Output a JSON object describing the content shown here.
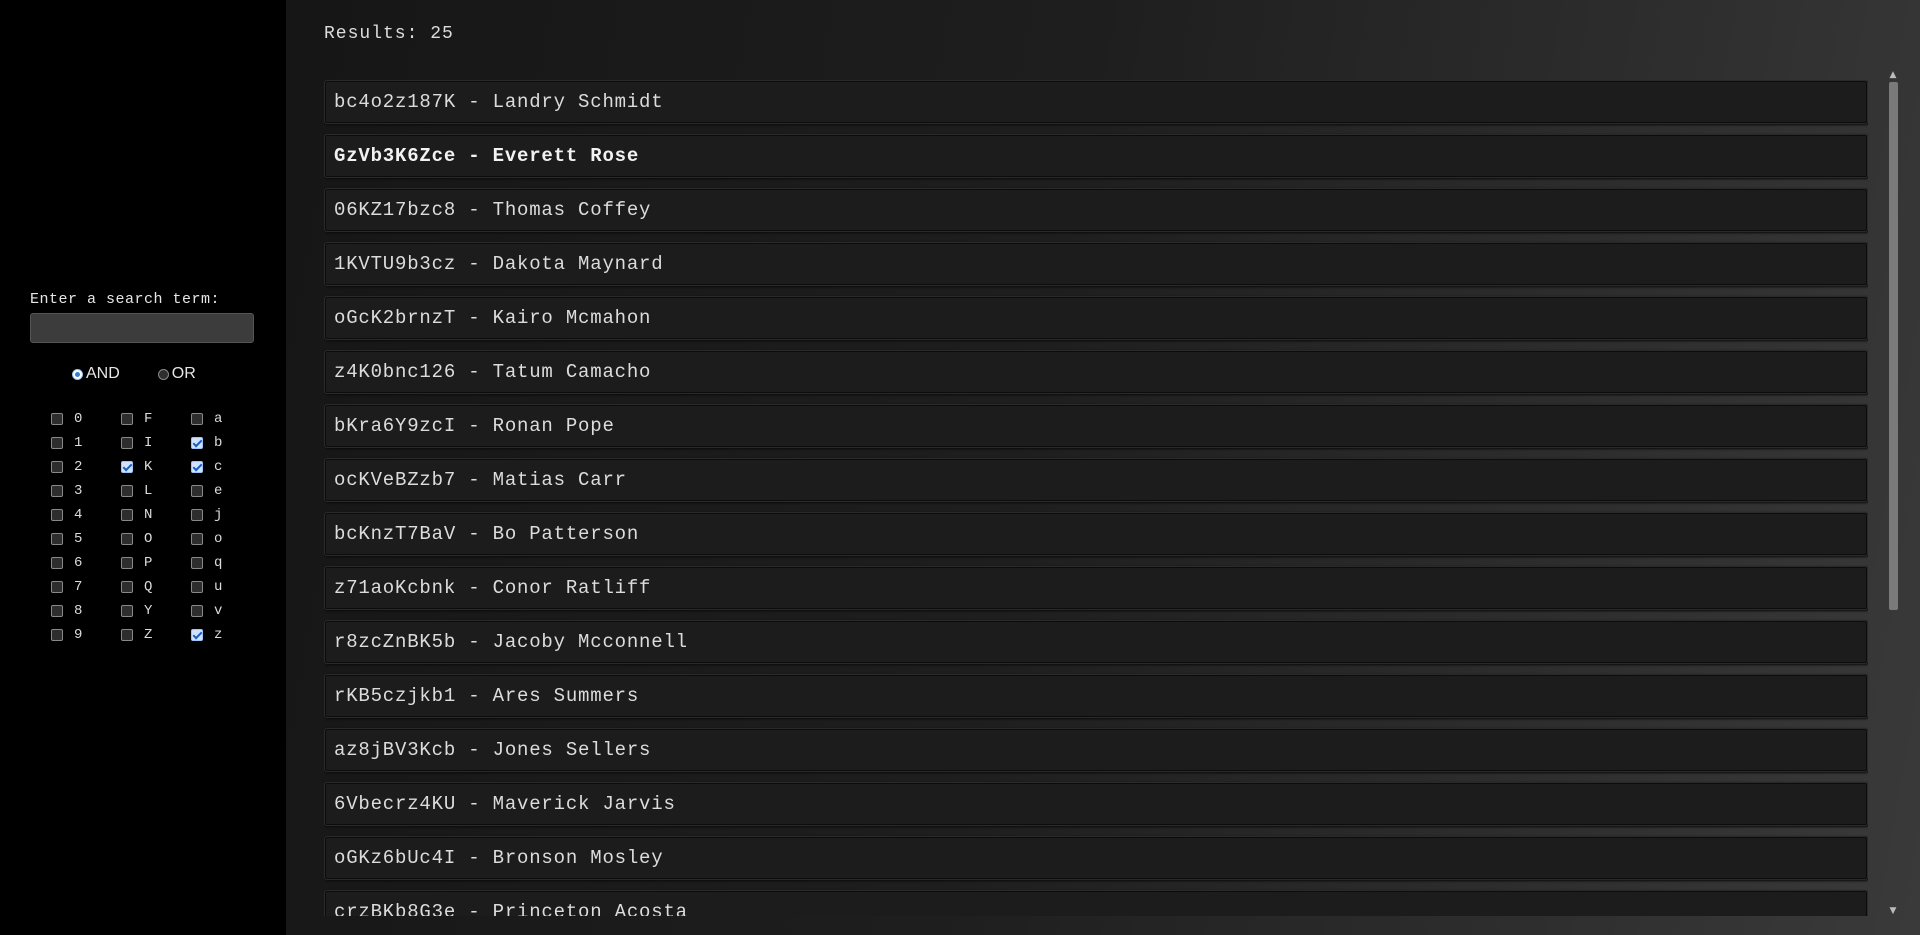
{
  "sidebar": {
    "search_label": "Enter a search term:",
    "search_value": "",
    "search_placeholder": "",
    "mode_options": [
      {
        "label": "AND",
        "checked": true
      },
      {
        "label": "OR",
        "checked": false
      }
    ],
    "filters": [
      {
        "label": "0",
        "checked": false
      },
      {
        "label": "F",
        "checked": false
      },
      {
        "label": "a",
        "checked": false
      },
      {
        "label": "1",
        "checked": false
      },
      {
        "label": "I",
        "checked": false
      },
      {
        "label": "b",
        "checked": true
      },
      {
        "label": "2",
        "checked": false
      },
      {
        "label": "K",
        "checked": true
      },
      {
        "label": "c",
        "checked": true
      },
      {
        "label": "3",
        "checked": false
      },
      {
        "label": "L",
        "checked": false
      },
      {
        "label": "e",
        "checked": false
      },
      {
        "label": "4",
        "checked": false
      },
      {
        "label": "N",
        "checked": false
      },
      {
        "label": "j",
        "checked": false
      },
      {
        "label": "5",
        "checked": false
      },
      {
        "label": "O",
        "checked": false
      },
      {
        "label": "o",
        "checked": false
      },
      {
        "label": "6",
        "checked": false
      },
      {
        "label": "P",
        "checked": false
      },
      {
        "label": "q",
        "checked": false
      },
      {
        "label": "7",
        "checked": false
      },
      {
        "label": "Q",
        "checked": false
      },
      {
        "label": "u",
        "checked": false
      },
      {
        "label": "8",
        "checked": false
      },
      {
        "label": "Y",
        "checked": false
      },
      {
        "label": "v",
        "checked": false
      },
      {
        "label": "9",
        "checked": false
      },
      {
        "label": "Z",
        "checked": false
      },
      {
        "label": "z",
        "checked": true
      }
    ]
  },
  "main": {
    "results_label": "Results: 25",
    "results": [
      {
        "text": "bc4o2z187K - Landry Schmidt",
        "selected": false
      },
      {
        "text": "GzVb3K6Zce - Everett Rose",
        "selected": true
      },
      {
        "text": "06KZ17bzc8 - Thomas Coffey",
        "selected": false
      },
      {
        "text": "1KVTU9b3cz - Dakota Maynard",
        "selected": false
      },
      {
        "text": "oGcK2brnzT - Kairo Mcmahon",
        "selected": false
      },
      {
        "text": "z4K0bnc126 - Tatum Camacho",
        "selected": false
      },
      {
        "text": "bKra6Y9zcI - Ronan Pope",
        "selected": false
      },
      {
        "text": "ocKVeBZzb7 - Matias Carr",
        "selected": false
      },
      {
        "text": "bcKnzT7BaV - Bo Patterson",
        "selected": false
      },
      {
        "text": "z71aoKcbnk - Conor Ratliff",
        "selected": false
      },
      {
        "text": "r8zcZnBK5b - Jacoby Mcconnell",
        "selected": false
      },
      {
        "text": "rKB5czjkb1 - Ares Summers",
        "selected": false
      },
      {
        "text": "az8jBV3Kcb - Jones Sellers",
        "selected": false
      },
      {
        "text": "6Vbecrz4KU - Maverick Jarvis",
        "selected": false
      },
      {
        "text": "oGKz6bUc4I - Bronson Mosley",
        "selected": false
      },
      {
        "text": "crzBKb8G3e - Princeton Acosta",
        "selected": false
      }
    ]
  }
}
